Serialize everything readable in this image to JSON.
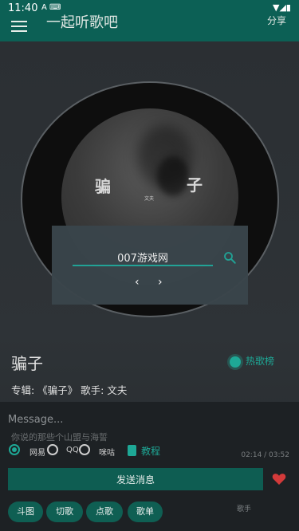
{
  "status_bar": {
    "time": "11:40",
    "left_icons": "A ⌨",
    "right_icons": "▼◢▮"
  },
  "app_bar": {
    "title": "一起听歌吧",
    "share_label": "分享"
  },
  "cover": {
    "char1": "骗",
    "char2": "子",
    "small_text": "文夫"
  },
  "search_dialog": {
    "input_value": "007游戏网",
    "prev_label": "‹",
    "next_label": "›"
  },
  "song": {
    "title": "骗子",
    "hot_songs_label": "热歌榜",
    "album_info": "专辑: 《骗子》 歌手: 文夫"
  },
  "chat": {
    "message_placeholder": "Message...",
    "lyric_line": "你说的那些个山盟与海誓",
    "time": "02:14 / 03:52",
    "sources": [
      {
        "label": "网易",
        "checked": true
      },
      {
        "label": "QQ",
        "checked": false
      },
      {
        "label": "咪咕",
        "checked": false
      }
    ],
    "tutorial_label": "教程",
    "send_label": "发送消息"
  },
  "actions": [
    {
      "label": "斗图"
    },
    {
      "label": "切歌"
    },
    {
      "label": "点歌"
    },
    {
      "label": "歌单"
    }
  ],
  "singer_label": "歌手",
  "colors": {
    "primary": "#0c6055",
    "accent": "#1ea896",
    "heart": "#d33a3a"
  }
}
